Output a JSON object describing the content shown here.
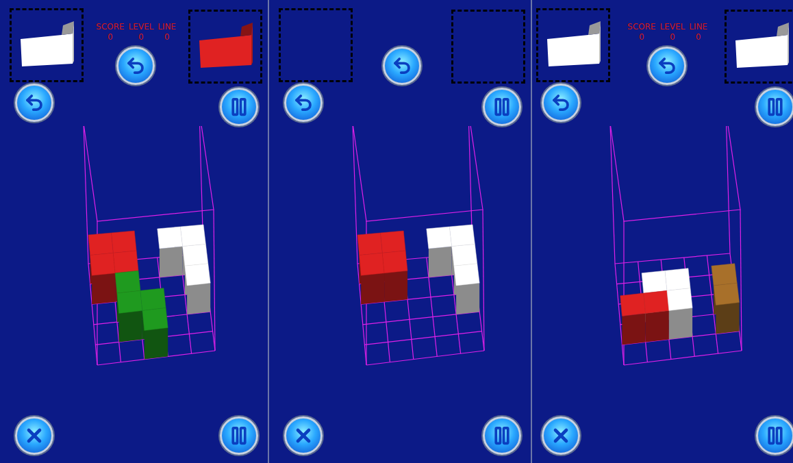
{
  "panels": [
    {
      "hold": {
        "empty": false,
        "color": "#ffffff"
      },
      "next": {
        "empty": false,
        "color": "#e02222"
      },
      "stats": [
        {
          "label": "SCORE",
          "value": "0"
        },
        {
          "label": "LEVEL",
          "value": "0"
        },
        {
          "label": "LINE",
          "value": "0"
        }
      ],
      "pieces": [
        {
          "name": "red-piece",
          "color": "#e02222",
          "height": 1,
          "cells": [
            [
              0,
              0
            ],
            [
              1,
              0
            ],
            [
              0,
              1
            ],
            [
              1,
              1
            ]
          ]
        },
        {
          "name": "white-piece",
          "color": "#ffffff",
          "height": 1,
          "cells": [
            [
              3,
              0
            ],
            [
              4,
              0
            ],
            [
              4,
              1
            ],
            [
              4,
              2
            ]
          ]
        },
        {
          "name": "green-piece",
          "color": "#1f9a1f",
          "height": 1,
          "cells": [
            [
              1,
              2
            ],
            [
              1,
              3
            ],
            [
              2,
              3
            ],
            [
              2,
              4
            ]
          ]
        }
      ]
    },
    {
      "hold": {
        "empty": true,
        "color": "#ffffff"
      },
      "next": {
        "empty": true,
        "color": "#ffffff"
      },
      "stats": [],
      "pieces": [
        {
          "name": "red-piece",
          "color": "#e02222",
          "height": 1,
          "cells": [
            [
              0,
              0
            ],
            [
              1,
              0
            ],
            [
              0,
              1
            ],
            [
              1,
              1
            ]
          ]
        },
        {
          "name": "white-piece",
          "color": "#ffffff",
          "height": 1,
          "cells": [
            [
              3,
              0
            ],
            [
              4,
              0
            ],
            [
              4,
              1
            ],
            [
              4,
              2
            ]
          ]
        }
      ]
    },
    {
      "hold": {
        "empty": false,
        "color": "#ffffff"
      },
      "next": {
        "empty": false,
        "color": "#ffffff"
      },
      "stats": [
        {
          "label": "SCORE",
          "value": "0"
        },
        {
          "label": "LEVEL",
          "value": "0"
        },
        {
          "label": "LINE",
          "value": "0"
        }
      ],
      "pieces": [
        {
          "name": "white-piece",
          "color": "#ffffff",
          "height": 1,
          "cells": [
            [
              1,
              2
            ],
            [
              2,
              2
            ],
            [
              2,
              3
            ]
          ]
        },
        {
          "name": "red-piece",
          "color": "#e02222",
          "height": 1,
          "cells": [
            [
              0,
              3
            ],
            [
              1,
              3
            ]
          ]
        },
        {
          "name": "brown-piece",
          "color": "#a8702a",
          "height": 1,
          "cells": [
            [
              4,
              2
            ],
            [
              4,
              3
            ]
          ]
        }
      ]
    }
  ]
}
